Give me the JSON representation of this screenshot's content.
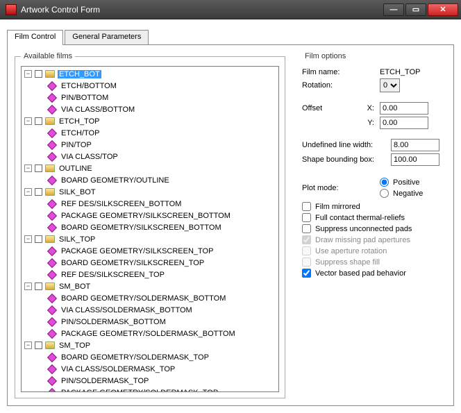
{
  "window": {
    "title": "Artwork Control Form"
  },
  "tabs": {
    "film_control": "Film Control",
    "general_parameters": "General Parameters"
  },
  "tree": {
    "legend": "Available films",
    "nodes": [
      {
        "label": "ETCH_BOT",
        "selected": true,
        "children": [
          {
            "label": "ETCH/BOTTOM"
          },
          {
            "label": "PIN/BOTTOM"
          },
          {
            "label": "VIA CLASS/BOTTOM"
          }
        ]
      },
      {
        "label": "ETCH_TOP",
        "children": [
          {
            "label": "ETCH/TOP"
          },
          {
            "label": "PIN/TOP"
          },
          {
            "label": "VIA CLASS/TOP"
          }
        ]
      },
      {
        "label": "OUTLINE",
        "children": [
          {
            "label": "BOARD GEOMETRY/OUTLINE"
          }
        ]
      },
      {
        "label": "SILK_BOT",
        "children": [
          {
            "label": "REF DES/SILKSCREEN_BOTTOM"
          },
          {
            "label": "PACKAGE GEOMETRY/SILKSCREEN_BOTTOM"
          },
          {
            "label": "BOARD GEOMETRY/SILKSCREEN_BOTTOM"
          }
        ]
      },
      {
        "label": "SILK_TOP",
        "children": [
          {
            "label": "PACKAGE GEOMETRY/SILKSCREEN_TOP"
          },
          {
            "label": "BOARD GEOMETRY/SILKSCREEN_TOP"
          },
          {
            "label": "REF DES/SILKSCREEN_TOP"
          }
        ]
      },
      {
        "label": "SM_BOT",
        "children": [
          {
            "label": "BOARD GEOMETRY/SOLDERMASK_BOTTOM"
          },
          {
            "label": "VIA CLASS/SOLDERMASK_BOTTOM"
          },
          {
            "label": "PIN/SOLDERMASK_BOTTOM"
          },
          {
            "label": "PACKAGE GEOMETRY/SOLDERMASK_BOTTOM"
          }
        ]
      },
      {
        "label": "SM_TOP",
        "children": [
          {
            "label": "BOARD GEOMETRY/SOLDERMASK_TOP"
          },
          {
            "label": "VIA CLASS/SOLDERMASK_TOP"
          },
          {
            "label": "PIN/SOLDERMASK_TOP"
          },
          {
            "label": "PACKAGE GEOMETRY/SOLDERMASK_TOP"
          }
        ]
      }
    ]
  },
  "options": {
    "legend": "Film options",
    "film_name_label": "Film name:",
    "film_name_value": "ETCH_TOP",
    "rotation_label": "Rotation:",
    "rotation_value": "0",
    "offset_label": "Offset",
    "offset_x_label": "X:",
    "offset_x_value": "0.00",
    "offset_y_label": "Y:",
    "offset_y_value": "0.00",
    "ulw_label": "Undefined line width:",
    "ulw_value": "8.00",
    "sbb_label": "Shape bounding box:",
    "sbb_value": "100.00",
    "plot_mode_label": "Plot mode:",
    "plot_positive": "Positive",
    "plot_negative": "Negative",
    "chk_mirrored": "Film mirrored",
    "chk_thermal": "Full contact thermal-reliefs",
    "chk_suppress_unconnected": "Suppress unconnected pads",
    "chk_draw_missing": "Draw missing pad apertures",
    "chk_aperture_rot": "Use aperture rotation",
    "chk_suppress_shape": "Suppress shape fill",
    "chk_vector_pad": "Vector based pad behavior"
  }
}
